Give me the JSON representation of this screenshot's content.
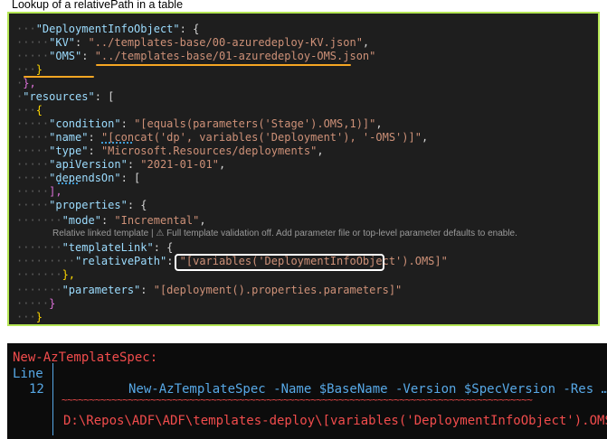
{
  "caption": "Lookup of a relativePath in a table",
  "lens_text": "Relative linked template | ⚠ Full template validation off. Add parameter file or top-level parameter defaults to enable.",
  "code": {
    "l1_key": "\"DeploymentInfoObject\"",
    "l1_rest": ": {",
    "l2_key": "\"KV\"",
    "l2_val": "\"../templates-base/00-azuredeploy-KV.json\"",
    "l3_key": "\"OMS\"",
    "l3_val": "\"../templates-base/01-azuredeploy-OMS.json\"",
    "l4": "}",
    "l5": "},",
    "l6_key": "\"resources\"",
    "l6_rest": ": [",
    "l7": "{",
    "l8_key": "\"condition\"",
    "l8_val": "\"[equals(parameters('Stage').OMS,1)]\"",
    "l9_key": "\"name\"",
    "l9_val": "\"[concat('dp', variables('Deployment'), '-OMS')]\"",
    "l10_key": "\"type\"",
    "l10_val": "\"Microsoft.Resources/deployments\"",
    "l11_key": "\"apiVersion\"",
    "l11_val": "\"2021-01-01\"",
    "l12_key": "\"dependsOn\"",
    "l12_rest": ": [",
    "l13": "],",
    "l14_key": "\"properties\"",
    "l14_rest": ": {",
    "l15_key": "\"mode\"",
    "l15_val": "\"Incremental\"",
    "l16_key": "\"templateLink\"",
    "l16_rest": ": {",
    "l17_key": "\"relativePath\"",
    "l17_val": "\"[variables('DeploymentInfoObject').OMS]\"",
    "l18": "},",
    "l19_key": "\"parameters\"",
    "l19_val": "\"[deployment().properties.parameters]\"",
    "l20": "}",
    "l21": "}"
  },
  "terminal": {
    "cmd_name": "New-AzTemplateSpec:",
    "line_label": "Line",
    "line_num": "12",
    "line_code": "New-AzTemplateSpec -Name $BaseName -Version $SpecVersion -Res …",
    "tildes": "~~~~~~~~~~~~~~~~~~~~~~~~~~~~~~~~~~~~~~~~~~~~~~~~~~~~~~~~~~~~~~~~~~~~~~~~~~~~~~~~~~~~~",
    "error_path": "D:\\Repos\\ADF\\ADF\\templates-deploy\\[variables('DeploymentInfoObject').OMS]"
  },
  "colors": {
    "border_accent": "#b5e655",
    "highlight": "#f5a623"
  }
}
